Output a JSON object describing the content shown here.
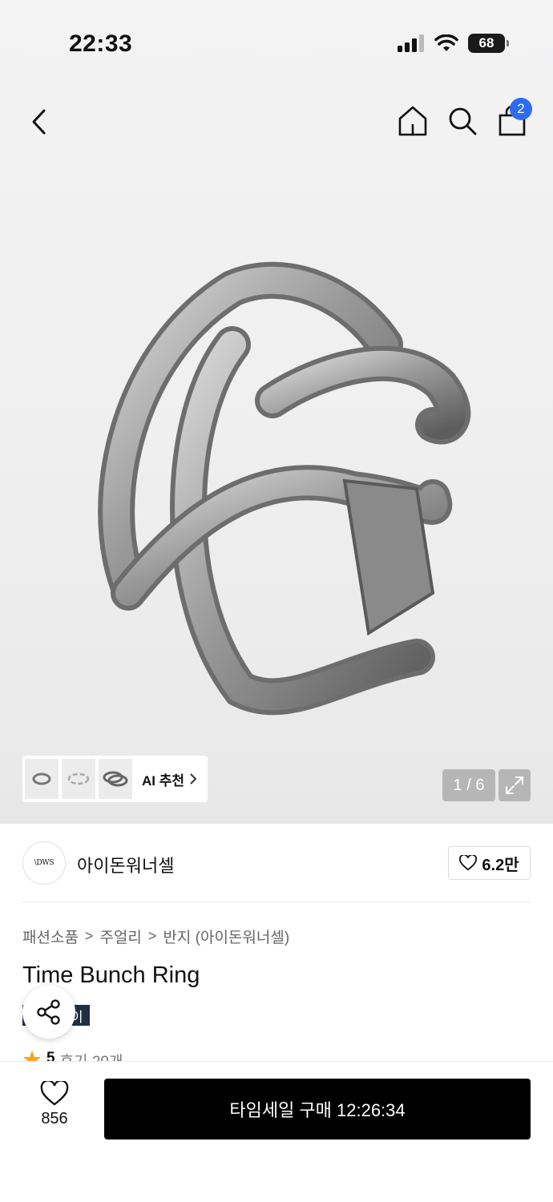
{
  "status_bar": {
    "time": "22:33",
    "battery": "68"
  },
  "nav": {
    "cart_count": "2"
  },
  "gallery": {
    "ai_label": "AI 추천",
    "page_counter": "1 / 6"
  },
  "brand": {
    "logo_text": "\\DWS",
    "name": "아이돈워너셀",
    "likes": "6.2만"
  },
  "breadcrumb": [
    "패션소품",
    "주얼리",
    "반지 (아이돈워너셀)"
  ],
  "product": {
    "title": "Time Bunch Ring",
    "tag": "이",
    "rating": "5",
    "reviews": "후기 20개"
  },
  "bottom": {
    "wish_count": "856",
    "buy_label": "타임세일 구매 12:26:34"
  },
  "colors": {
    "badge": "#2d6cf0",
    "buy_button": "#000000",
    "tag": "#1f3044",
    "star": "#f5a623"
  }
}
